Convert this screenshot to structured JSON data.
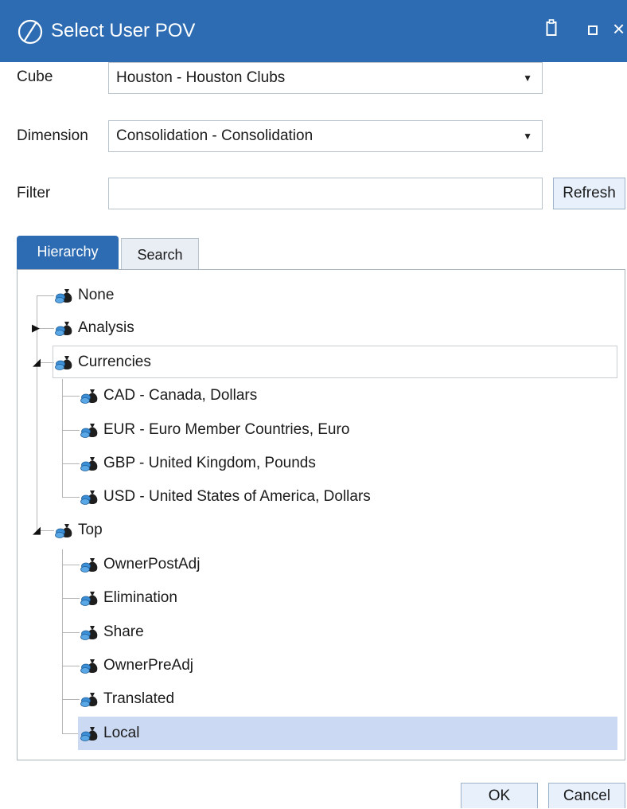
{
  "window": {
    "title": "Select User POV",
    "close_glyph": "×"
  },
  "form": {
    "cube_label": "Cube",
    "cube_value": "Houston - Houston Clubs",
    "dimension_label": "Dimension",
    "dimension_value": "Consolidation - Consolidation",
    "filter_label": "Filter",
    "filter_value": "",
    "refresh_label": "Refresh"
  },
  "tabs": [
    {
      "label": "Hierarchy",
      "active": true
    },
    {
      "label": "Search",
      "active": false
    }
  ],
  "tree": {
    "icon": "member-bag-icon",
    "nodes": [
      {
        "label": "None"
      },
      {
        "label": "Analysis",
        "expander": "collapsed"
      },
      {
        "label": "Currencies",
        "expander": "expanded",
        "selected": true
      },
      {
        "label": "CAD - Canada, Dollars"
      },
      {
        "label": "EUR - Euro Member Countries, Euro"
      },
      {
        "label": "GBP - United Kingdom, Pounds"
      },
      {
        "label": "USD - United States of America, Dollars"
      },
      {
        "label": "Top",
        "expander": "expanded"
      },
      {
        "label": "OwnerPostAdj"
      },
      {
        "label": "Elimination"
      },
      {
        "label": "Share"
      },
      {
        "label": "OwnerPreAdj"
      },
      {
        "label": "Translated"
      },
      {
        "label": "Local",
        "highlighted": true
      }
    ]
  },
  "footer": {
    "ok_label": "OK",
    "cancel_label": "Cancel"
  },
  "colors": {
    "titlebar": "#2d6cb2",
    "highlight": "#cbd9f2",
    "button": "#e7f0fb"
  }
}
